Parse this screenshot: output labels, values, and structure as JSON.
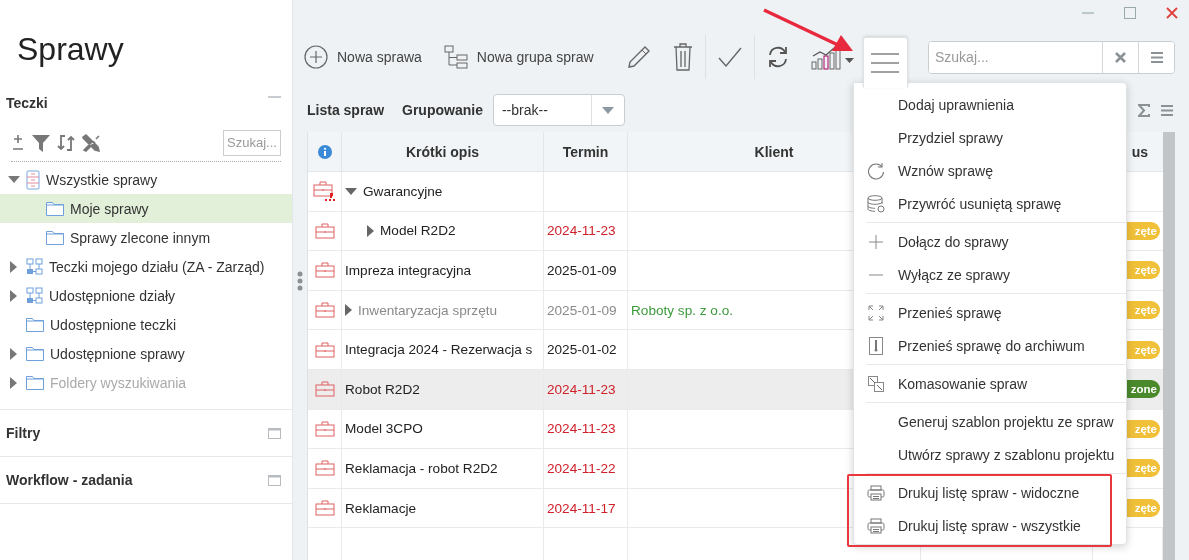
{
  "app_title": "Sprawy",
  "sidebar": {
    "panels": [
      {
        "title": "Teczki",
        "expanded": true,
        "search": {
          "placeholder": "Szukaj..."
        },
        "tree": [
          {
            "label": "Wszystkie sprawy",
            "kind": "cabinet",
            "expanded": true,
            "selected": false,
            "disabled": false,
            "children": [
              {
                "label": "Moje sprawy",
                "kind": "folder",
                "selected": true,
                "disabled": false
              },
              {
                "label": "Sprawy zlecone innym",
                "kind": "folder",
                "selected": false,
                "disabled": false
              }
            ]
          },
          {
            "label": "Teczki mojego działu (ZA - Zarząd)",
            "kind": "department",
            "expanded": false,
            "selected": false,
            "disabled": false
          },
          {
            "label": "Udostępnione działy",
            "kind": "department",
            "expanded": false,
            "selected": false,
            "disabled": false
          },
          {
            "label": "Udostępnione teczki",
            "kind": "folder",
            "selected": false,
            "disabled": false
          },
          {
            "label": "Udostępnione sprawy",
            "kind": "folder",
            "expanded": false,
            "selected": false,
            "disabled": false
          },
          {
            "label": "Foldery wyszukiwania",
            "kind": "folder",
            "expanded": false,
            "selected": false,
            "disabled": true
          }
        ]
      },
      {
        "title": "Filtry",
        "expanded": false
      },
      {
        "title": "Workflow - zadania",
        "expanded": false
      }
    ]
  },
  "toolbar": {
    "new_case": "Nowa sprawa",
    "new_group": "Nowa grupa spraw",
    "menu_open": true
  },
  "search": {
    "placeholder": "Szukaj..."
  },
  "list_bar": {
    "title": "Lista spraw",
    "grouping_label": "Grupowanie",
    "grouping_value": "--brak--"
  },
  "menu": {
    "groups": [
      {
        "highlighted": false,
        "items": [
          {
            "kind": "plain",
            "label": "Dodaj uprawnienia"
          },
          {
            "kind": "plain",
            "label": "Przydziel sprawy"
          },
          {
            "kind": "resume",
            "label": "Wznów sprawę"
          },
          {
            "kind": "restore",
            "label": "Przywróć usuniętą sprawę"
          }
        ]
      },
      {
        "highlighted": false,
        "items": [
          {
            "kind": "add",
            "label": "Dołącz do sprawy"
          },
          {
            "kind": "remove",
            "label": "Wyłącz ze sprawy"
          }
        ]
      },
      {
        "highlighted": false,
        "items": [
          {
            "kind": "move",
            "label": "Przenieś sprawę"
          },
          {
            "kind": "archive",
            "label": "Przenieś sprawę do archiwum"
          }
        ]
      },
      {
        "highlighted": false,
        "items": [
          {
            "kind": "merge",
            "label": "Komasowanie spraw"
          }
        ]
      },
      {
        "highlighted": false,
        "items": [
          {
            "kind": "plain",
            "label": "Generuj szablon projektu ze spraw"
          },
          {
            "kind": "plain",
            "label": "Utwórz sprawy z szablonu projektu"
          }
        ]
      },
      {
        "highlighted": true,
        "items": [
          {
            "kind": "print",
            "label": "Drukuj listę spraw - widoczne"
          },
          {
            "kind": "print",
            "label": "Drukuj listę spraw - wszystkie"
          }
        ]
      }
    ]
  },
  "table": {
    "columns": [
      "Krótki opis",
      "Termin",
      "Klient",
      "us"
    ],
    "rows": [
      {
        "kind": "group",
        "title": "Gwarancyjne",
        "expanded": true,
        "selected": false,
        "muted": false,
        "children": [
          {
            "kind": "case",
            "title": "Model R2D2",
            "expanded": false,
            "due": "2024-11-23",
            "overdue": true,
            "selected": false,
            "muted": false,
            "status": {
              "text": "zęte",
              "color": "#f0c039"
            }
          }
        ]
      },
      {
        "kind": "case",
        "title": "Impreza integracyjna",
        "due": "2025-01-09",
        "overdue": false,
        "selected": false,
        "muted": false,
        "status": {
          "text": "zęte",
          "color": "#f0c039"
        }
      },
      {
        "kind": "case",
        "title": "Inwentaryzacja sprzętu",
        "expanded": false,
        "due": "2025-01-09",
        "overdue": false,
        "client": "Roboty sp. z o.o.",
        "selected": false,
        "muted": true,
        "status": {
          "text": "zęte",
          "color": "#f0c039"
        }
      },
      {
        "kind": "case",
        "title": "Integracja 2024 - Rezerwacja s",
        "due": "2025-01-02",
        "overdue": false,
        "selected": false,
        "muted": false,
        "status": {
          "text": "zęte",
          "color": "#f0c039"
        }
      },
      {
        "kind": "case",
        "title": "Robot R2D2",
        "due": "2024-11-23",
        "overdue": true,
        "selected": true,
        "muted": false,
        "status": {
          "text": "zone",
          "color": "#4b8a2c"
        }
      },
      {
        "kind": "case",
        "title": "Model 3CPO",
        "due": "2024-11-23",
        "overdue": true,
        "selected": false,
        "muted": false,
        "status": {
          "text": "zęte",
          "color": "#f0c039"
        }
      },
      {
        "kind": "case",
        "title": "Reklamacja - robot R2D2",
        "due": "2024-11-22",
        "overdue": true,
        "selected": false,
        "muted": false,
        "status": {
          "text": "zęte",
          "color": "#f0c039"
        }
      },
      {
        "kind": "case",
        "title": "Reklamacje",
        "due": "2024-11-17",
        "overdue": true,
        "selected": false,
        "muted": false,
        "status": {
          "text": "zęte",
          "color": "#f0c039"
        }
      }
    ]
  }
}
